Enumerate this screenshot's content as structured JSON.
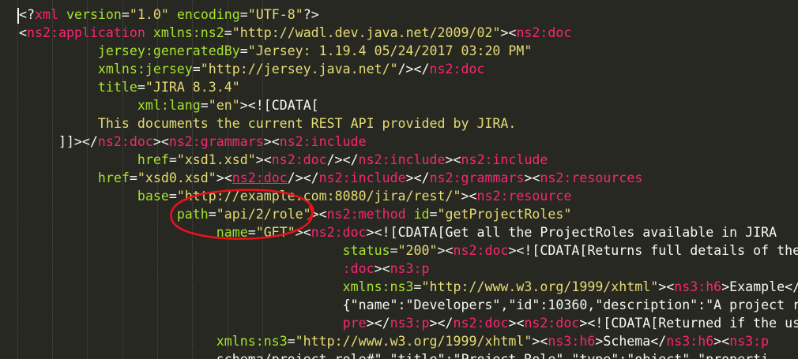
{
  "colors": {
    "background": "#272822",
    "tag": "#f92672",
    "attribute": "#a6e22e",
    "string": "#e6db74",
    "plain": "#f8f8f2",
    "annotation": "#e8121b"
  },
  "lines": [
    {
      "indent": 0,
      "segments": [
        [
          "p",
          "<?"
        ],
        [
          "t",
          "xml"
        ],
        [
          "p",
          " "
        ],
        [
          "a",
          "version"
        ],
        [
          "p",
          "="
        ],
        [
          "v",
          "\"1.0\""
        ],
        [
          "p",
          " "
        ],
        [
          "a",
          "encoding"
        ],
        [
          "p",
          "="
        ],
        [
          "v",
          "\"UTF-8\""
        ],
        [
          "p",
          "?>"
        ]
      ]
    },
    {
      "indent": 0,
      "segments": [
        [
          "p",
          "<"
        ],
        [
          "t",
          "ns2:application"
        ],
        [
          "p",
          " "
        ],
        [
          "a",
          "xmlns:ns2"
        ],
        [
          "p",
          "="
        ],
        [
          "v",
          "\"http://wadl.dev.java.net/2009/02\""
        ],
        [
          "p",
          "><"
        ],
        [
          "t",
          "ns2:doc"
        ]
      ]
    },
    {
      "indent": 10,
      "segments": [
        [
          "a",
          "jersey:generatedBy"
        ],
        [
          "p",
          "="
        ],
        [
          "v",
          "\"Jersey: 1.19.4 05/24/2017 03:20 PM\""
        ]
      ]
    },
    {
      "indent": 10,
      "segments": [
        [
          "a",
          "xmlns:jersey"
        ],
        [
          "p",
          "="
        ],
        [
          "v",
          "\"http://jersey.java.net/\""
        ],
        [
          "p",
          "/></"
        ],
        [
          "t",
          "ns2:doc"
        ]
      ]
    },
    {
      "indent": 10,
      "segments": [
        [
          "a",
          "title"
        ],
        [
          "p",
          "="
        ],
        [
          "v",
          "\"JIRA 8.3.4\""
        ]
      ]
    },
    {
      "indent": 15,
      "segments": [
        [
          "a",
          "xml:lang"
        ],
        [
          "p",
          "="
        ],
        [
          "v",
          "\"en\""
        ],
        [
          "p",
          "><![CDATA["
        ]
      ]
    },
    {
      "indent": 10,
      "segments": [
        [
          "c",
          "This documents the current REST API provided by JIRA."
        ]
      ]
    },
    {
      "indent": 5,
      "segments": [
        [
          "p",
          "]]></"
        ],
        [
          "t",
          "ns2:doc"
        ],
        [
          "p",
          "><"
        ],
        [
          "t",
          "ns2:grammars"
        ],
        [
          "p",
          "><"
        ],
        [
          "t",
          "ns2:include"
        ]
      ]
    },
    {
      "indent": 15,
      "segments": [
        [
          "a",
          "href"
        ],
        [
          "p",
          "="
        ],
        [
          "v",
          "\"xsd1.xsd\""
        ],
        [
          "p",
          "><"
        ],
        [
          "t",
          "ns2:doc"
        ],
        [
          "p",
          "/></"
        ],
        [
          "t",
          "ns2:include"
        ],
        [
          "p",
          "><"
        ],
        [
          "t",
          "ns2:include"
        ]
      ]
    },
    {
      "indent": 10,
      "segments": [
        [
          "a",
          "href"
        ],
        [
          "p",
          "="
        ],
        [
          "v",
          "\"xsd0.xsd\""
        ],
        [
          "p",
          "><"
        ],
        [
          "tu",
          "ns2:doc"
        ],
        [
          "p",
          "/></"
        ],
        [
          "t",
          "ns2:include"
        ],
        [
          "p",
          "></"
        ],
        [
          "t",
          "ns2:grammars"
        ],
        [
          "p",
          "><"
        ],
        [
          "t",
          "ns2:resources"
        ]
      ]
    },
    {
      "indent": 15,
      "segments": [
        [
          "a",
          "base"
        ],
        [
          "p",
          "="
        ],
        [
          "v",
          "\"http://example.com:8080/jira/rest/\""
        ],
        [
          "p",
          "><"
        ],
        [
          "t",
          "ns2:resource"
        ]
      ]
    },
    {
      "indent": 20,
      "segments": [
        [
          "a",
          "path"
        ],
        [
          "p",
          "="
        ],
        [
          "v",
          "\"api/2/role\""
        ],
        [
          "p",
          "><"
        ],
        [
          "t",
          "ns2:method"
        ],
        [
          "p",
          " "
        ],
        [
          "a",
          "id"
        ],
        [
          "p",
          "="
        ],
        [
          "v",
          "\"getProjectRoles\""
        ]
      ]
    },
    {
      "indent": 25,
      "segments": [
        [
          "a",
          "name"
        ],
        [
          "p",
          "="
        ],
        [
          "v",
          "\"GET\""
        ],
        [
          "p",
          "><"
        ],
        [
          "t",
          "ns2:doc"
        ],
        [
          "p",
          "><![CDATA[Get all the ProjectRoles available in JIRA"
        ]
      ]
    },
    {
      "indent": 41,
      "segments": [
        [
          "a",
          "status"
        ],
        [
          "p",
          "="
        ],
        [
          "v",
          "\"200\""
        ],
        [
          "p",
          "><"
        ],
        [
          "t",
          "ns2:doc"
        ],
        [
          "p",
          "><![CDATA[Returns full details of the"
        ]
      ]
    },
    {
      "indent": 41,
      "segments": [
        [
          "t",
          ":doc"
        ],
        [
          "p",
          "><"
        ],
        [
          "t",
          "ns3:p"
        ]
      ]
    },
    {
      "indent": 41,
      "segments": [
        [
          "a",
          "xmlns:ns3"
        ],
        [
          "p",
          "="
        ],
        [
          "v",
          "\"http://www.w3.org/1999/xhtml\""
        ],
        [
          "p",
          "><"
        ],
        [
          "t",
          "ns3:h6"
        ],
        [
          "p",
          ">Example</"
        ]
      ]
    },
    {
      "indent": 41,
      "segments": [
        [
          "p",
          "{\"name\":\"Developers\",\"id\":10360,\"description\":\"A project r"
        ]
      ]
    },
    {
      "indent": 41,
      "segments": [
        [
          "t",
          "pre"
        ],
        [
          "p",
          "></"
        ],
        [
          "t",
          "ns3:p"
        ],
        [
          "p",
          "></"
        ],
        [
          "t",
          "ns2:doc"
        ],
        [
          "p",
          "><"
        ],
        [
          "t",
          "ns2:doc"
        ],
        [
          "p",
          "><![CDATA[Returned if the us"
        ]
      ]
    },
    {
      "indent": 25,
      "segments": [
        [
          "a",
          "xmlns:ns3"
        ],
        [
          "p",
          "="
        ],
        [
          "v",
          "\"http://www.w3.org/1999/xhtml\""
        ],
        [
          "p",
          "><"
        ],
        [
          "t",
          "ns3:h6"
        ],
        [
          "p",
          ">Schema</"
        ],
        [
          "t",
          "ns3:h6"
        ],
        [
          "p",
          "><"
        ],
        [
          "t",
          "ns3:p"
        ]
      ]
    },
    {
      "indent": 25,
      "segments": [
        [
          "p",
          "schema/project-role#\",\"title\":\"Project Role\",\"type\":\"object\",\"properti"
        ]
      ]
    }
  ]
}
